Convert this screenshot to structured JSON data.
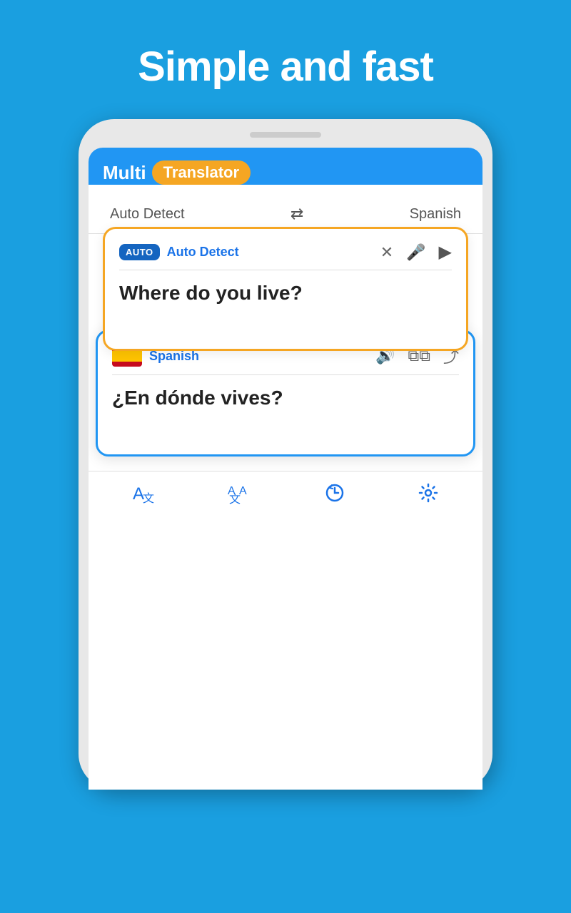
{
  "background_color": "#1a9fe0",
  "headline": "Simple and fast",
  "phone": {
    "app_name_prefix": "Multi",
    "app_name_suffix": "Translator",
    "lang_bar": {
      "source_lang": "Auto Detect",
      "target_lang": "Spanish",
      "swap_symbol": "⇄"
    },
    "input_card": {
      "badge": "AUTO",
      "lang_name": "Auto Detect",
      "clear_label": "✕",
      "mic_label": "mic",
      "send_label": "send",
      "input_text": "Where do you live?"
    },
    "output_card": {
      "lang_name": "Spanish",
      "speaker_label": "speaker",
      "copy_label": "copy",
      "share_label": "share",
      "output_text": "¿En dónde vives?"
    },
    "bottom_nav": {
      "items": [
        {
          "id": "translate",
          "label": "translate-icon"
        },
        {
          "id": "translate-alt",
          "label": "translate-alt-icon"
        },
        {
          "id": "history",
          "label": "history-icon"
        },
        {
          "id": "settings",
          "label": "settings-icon"
        }
      ]
    }
  }
}
